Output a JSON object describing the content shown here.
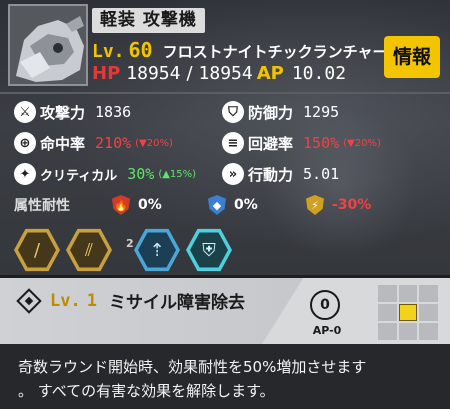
{
  "unit": {
    "type_badge": "軽装 攻撃機",
    "level_label": "Lv.",
    "level_value": "60",
    "name": "フロストナイトチックランチャー",
    "hp_label": "HP",
    "hp_current": "18954",
    "hp_separator": "/",
    "hp_max": "18954",
    "ap_label": "AP",
    "ap_value": "10.02",
    "info_button": "情報"
  },
  "stats": {
    "attack": {
      "label": "攻撃力",
      "value": "1836",
      "icon": "sword-icon"
    },
    "defense": {
      "label": "防御力",
      "value": "1295",
      "icon": "shield-icon"
    },
    "accuracy": {
      "label": "命中率",
      "value": "210%",
      "change": "(▼20%)",
      "icon": "crosshair-icon"
    },
    "evasion": {
      "label": "回避率",
      "value": "150%",
      "change": "(▼20%)",
      "icon": "evasion-icon"
    },
    "critical": {
      "label": "クリティカル",
      "value": "30%",
      "change": "(▲15%)",
      "icon": "crit-icon"
    },
    "speed": {
      "label": "行動力",
      "value": "5.01",
      "icon": "speed-icon"
    }
  },
  "resistances": {
    "label": "属性耐性",
    "fire": {
      "value": "0%",
      "color": "#d23a2a"
    },
    "ice": {
      "value": "0%",
      "color": "#3a7fd0"
    },
    "electric": {
      "value": "-30%",
      "color": "#d0a020"
    }
  },
  "skills": {
    "slot_number": "2",
    "icons": [
      "dagger-skill-icon",
      "multi-arrow-skill-icon",
      "missile-skill-icon",
      "shield-skill-icon"
    ]
  },
  "selected_skill": {
    "level_label": "Lv.",
    "level_value": "1",
    "name": "ミサイル障害除去",
    "ap_cost": "0",
    "ap_cost_label": "AP-0",
    "range_grid": [
      false,
      false,
      false,
      false,
      true,
      false,
      false,
      false,
      false
    ]
  },
  "description": {
    "line1": "奇数ラウンド開始時、効果耐性を50%増加させます",
    "line2": "。 すべての有害な効果を解除します。"
  }
}
